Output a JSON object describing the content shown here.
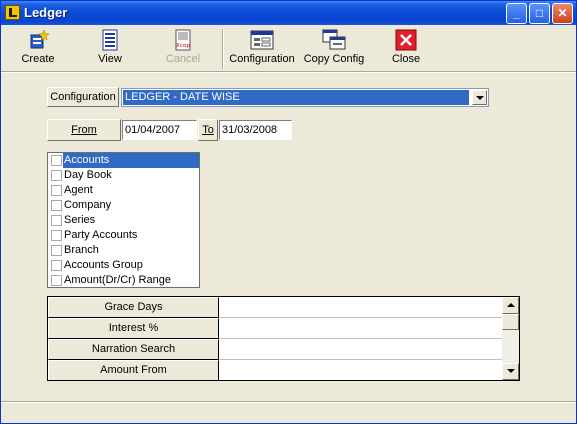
{
  "window": {
    "title": "Ledger",
    "controls": {
      "minimize": "_",
      "maximize": "□",
      "close": "✕"
    }
  },
  "toolbar": {
    "create_label": "Create",
    "view_label": "View",
    "cancel_label": "Cancel",
    "configuration_label": "Configuration",
    "copy_config_label": "Copy Config",
    "close_label": "Close",
    "cancel_icon_text": "Xcop"
  },
  "form": {
    "configuration_label": "Configuration",
    "configuration_value": "LEDGER - DATE WISE",
    "from_label": "From",
    "from_value": "01/04/2007",
    "to_label": "To",
    "to_value": "31/03/2008"
  },
  "filters": {
    "items": [
      {
        "label": "Accounts",
        "selected": true,
        "checked": false
      },
      {
        "label": "Day Book",
        "selected": false,
        "checked": false
      },
      {
        "label": "Agent",
        "selected": false,
        "checked": false
      },
      {
        "label": "Company",
        "selected": false,
        "checked": false
      },
      {
        "label": "Series",
        "selected": false,
        "checked": false
      },
      {
        "label": "Party Accounts",
        "selected": false,
        "checked": false
      },
      {
        "label": "Branch",
        "selected": false,
        "checked": false
      },
      {
        "label": "Accounts Group",
        "selected": false,
        "checked": false
      },
      {
        "label": "Amount(Dr/Cr) Range",
        "selected": false,
        "checked": false
      }
    ]
  },
  "grid": {
    "rows": [
      {
        "label": "Grace Days",
        "value": ""
      },
      {
        "label": "Interest %",
        "value": ""
      },
      {
        "label": "Narration Search",
        "value": ""
      },
      {
        "label": "Amount From",
        "value": ""
      }
    ]
  },
  "colors": {
    "title_bar": "#0a49d6",
    "selection": "#316ac5",
    "window_bg": "#ece9d8",
    "close_icon": "#e0202a"
  }
}
